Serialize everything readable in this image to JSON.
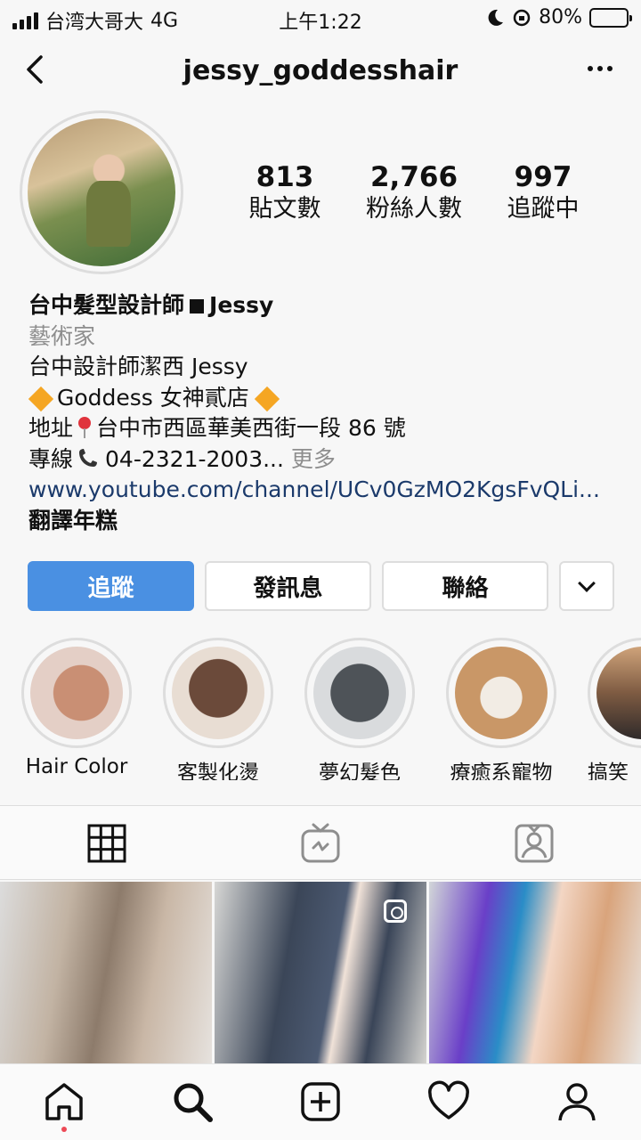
{
  "status_bar": {
    "carrier": "台湾大哥大",
    "network": "4G",
    "time": "上午1:22",
    "battery": "80%",
    "battery_level": 0.8
  },
  "header": {
    "username": "jessy_goddesshair"
  },
  "profile": {
    "posts_count": "813",
    "posts_label": "貼文數",
    "followers_count": "2,766",
    "followers_label": "粉絲人數",
    "following_count": "997",
    "following_label": "追蹤中"
  },
  "bio": {
    "name": "台中髮型設計師",
    "name_suffix": "Jessy",
    "category": "藝術家",
    "line1": "台中設計師潔西 Jessy",
    "line2": "Goddess 女神貳店",
    "line3_prefix": "地址",
    "line3": "台中市西區華美西街一段 86 號",
    "line4_prefix": "專線",
    "line4": "04-2321-2003...",
    "more": "更多",
    "link": "www.youtube.com/channel/UCv0GzMO2KgsFvQLi...",
    "translate": "翻譯年糕"
  },
  "buttons": {
    "follow": "追蹤",
    "message": "發訊息",
    "contact": "聯絡"
  },
  "highlights": [
    {
      "label": "Hair Color"
    },
    {
      "label": "客製化燙"
    },
    {
      "label": "夢幻髮色"
    },
    {
      "label": "療癒系寵物"
    },
    {
      "label": "搞笑"
    }
  ],
  "tabs": [
    "grid-icon",
    "igtv-icon",
    "tagged-icon"
  ],
  "nav": [
    "home-icon",
    "search-icon",
    "add-icon",
    "heart-icon",
    "profile-icon"
  ],
  "colors": {
    "follow_button": "#4a90e2",
    "link": "#1b3a6b",
    "notification_dot": "#ed4956",
    "battery_fill": "#4cd964"
  }
}
